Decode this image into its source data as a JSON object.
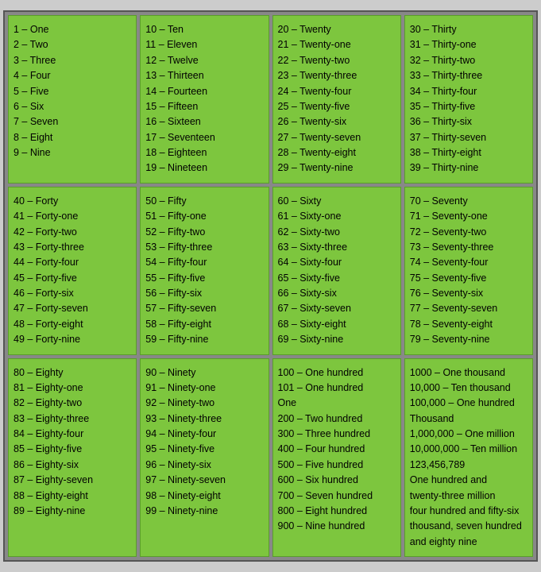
{
  "cells": [
    {
      "id": "cell-1-10",
      "lines": [
        "1 – One",
        "2  – Two",
        "3  – Three",
        "4  – Four",
        "5  – Five",
        "6  – Six",
        "7  – Seven",
        "8  – Eight",
        "9  – Nine"
      ]
    },
    {
      "id": "cell-10-19",
      "lines": [
        "10 – Ten",
        "11 – Eleven",
        "12 – Twelve",
        "13 – Thirteen",
        "14 – Fourteen",
        "15 – Fifteen",
        "16 – Sixteen",
        "17 – Seventeen",
        "18 – Eighteen",
        "19 – Nineteen"
      ]
    },
    {
      "id": "cell-20-29",
      "lines": [
        "20 – Twenty",
        "21 – Twenty-one",
        "22 – Twenty-two",
        "23 – Twenty-three",
        "24 – Twenty-four",
        "25 – Twenty-five",
        "26 – Twenty-six",
        "27 – Twenty-seven",
        "28 – Twenty-eight",
        "29 – Twenty-nine"
      ]
    },
    {
      "id": "cell-30-39",
      "lines": [
        "30 – Thirty",
        "31 – Thirty-one",
        "32 – Thirty-two",
        "33 – Thirty-three",
        "34 – Thirty-four",
        "35 – Thirty-five",
        "36 – Thirty-six",
        "37 – Thirty-seven",
        "38 – Thirty-eight",
        "39 – Thirty-nine"
      ]
    },
    {
      "id": "cell-40-49",
      "lines": [
        "40 – Forty",
        "41 – Forty-one",
        "42 – Forty-two",
        "43 – Forty-three",
        "44 – Forty-four",
        "45 – Forty-five",
        "46 – Forty-six",
        "47 – Forty-seven",
        "48 – Forty-eight",
        "49 – Forty-nine"
      ]
    },
    {
      "id": "cell-50-59",
      "lines": [
        "50 – Fifty",
        "51 – Fifty-one",
        "52 – Fifty-two",
        "53 – Fifty-three",
        "54 – Fifty-four",
        "55 – Fifty-five",
        "56 – Fifty-six",
        "57 – Fifty-seven",
        "58 – Fifty-eight",
        "59 – Fifty-nine"
      ]
    },
    {
      "id": "cell-60-69",
      "lines": [
        "60 – Sixty",
        "61 – Sixty-one",
        "62 – Sixty-two",
        "63 – Sixty-three",
        "64 – Sixty-four",
        "65 – Sixty-five",
        "66 – Sixty-six",
        "67 – Sixty-seven",
        "68 – Sixty-eight",
        "69 – Sixty-nine"
      ]
    },
    {
      "id": "cell-70-79",
      "lines": [
        "70 – Seventy",
        "71 – Seventy-one",
        "72 – Seventy-two",
        "73 – Seventy-three",
        "74 – Seventy-four",
        "75 – Seventy-five",
        "76 – Seventy-six",
        "77 – Seventy-seven",
        "78 – Seventy-eight",
        "79 – Seventy-nine"
      ]
    },
    {
      "id": "cell-80-89",
      "lines": [
        "80 – Eighty",
        "81 – Eighty-one",
        "82 – Eighty-two",
        "83 – Eighty-three",
        "84 – Eighty-four",
        "85 – Eighty-five",
        "86 – Eighty-six",
        "87 – Eighty-seven",
        "88 – Eighty-eight",
        "89 – Eighty-nine"
      ]
    },
    {
      "id": "cell-90-99",
      "lines": [
        "90 – Ninety",
        "91 – Ninety-one",
        "92 – Ninety-two",
        "93 – Ninety-three",
        "94 – Ninety-four",
        "95 – Ninety-five",
        "96 – Ninety-six",
        "97 – Ninety-seven",
        "98 – Ninety-eight",
        "99 – Ninety-nine"
      ]
    },
    {
      "id": "cell-100-900",
      "lines": [
        "100 – One hundred",
        "101 – One hundred",
        "        One",
        "200 – Two hundred",
        "300 – Three hundred",
        "400 – Four hundred",
        "500 – Five hundred",
        "600 – Six hundred",
        "700 – Seven hundred",
        "800 – Eight hundred",
        "900 – Nine hundred"
      ]
    },
    {
      "id": "cell-1000-plus",
      "lines": [
        "1000 – One thousand",
        "10,000 – Ten thousand",
        "100,000 – One hundred",
        "           Thousand",
        "1,000,000 – One million",
        "10,000,000 – Ten million",
        "     123,456,789",
        "One hundred and",
        "twenty-three million",
        "four hundred and fifty-six",
        "thousand, seven hundred",
        "and eighty nine"
      ]
    }
  ]
}
